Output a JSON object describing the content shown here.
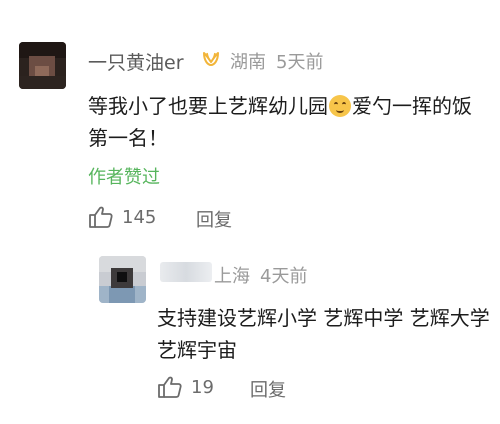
{
  "comment": {
    "username": "一只黄油er",
    "location": "湖南",
    "time": "5天前",
    "text_before_emoji": "等我小了也要上艺辉幼儿园",
    "text_after_emoji": "爱勺一挥的饭第一名！",
    "author_liked": "作者赞过",
    "like_count": "145",
    "reply_label": "回复"
  },
  "reply": {
    "location": "上海",
    "time": "4天前",
    "text": "支持建设艺辉小学 艺辉中学 艺辉大学 艺辉宇宙",
    "like_count": "19",
    "reply_label": "回复"
  },
  "colors": {
    "author_liked": "#57b55d",
    "badge": "#f2b53a",
    "meta": "#9a9a9a"
  }
}
